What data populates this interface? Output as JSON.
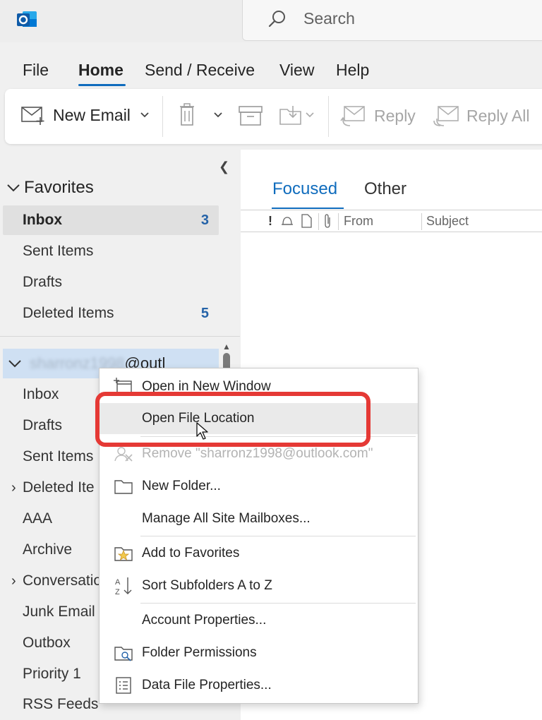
{
  "titlebar": {
    "app_icon": "outlook-logo-icon",
    "search_placeholder": "Search"
  },
  "menu_tabs": [
    {
      "label": "File",
      "active": false
    },
    {
      "label": "Home",
      "active": true
    },
    {
      "label": "Send / Receive",
      "active": false
    },
    {
      "label": "View",
      "active": false
    },
    {
      "label": "Help",
      "active": false
    }
  ],
  "ribbon": {
    "new_email": "New Email",
    "reply": "Reply",
    "reply_all": "Reply All"
  },
  "favorites": {
    "header": "Favorites",
    "items": [
      {
        "label": "Inbox",
        "count": "3",
        "selected": true
      },
      {
        "label": "Sent Items",
        "count": ""
      },
      {
        "label": "Drafts",
        "count": ""
      },
      {
        "label": "Deleted Items",
        "count": "5"
      }
    ]
  },
  "account": {
    "name_visible": "@outl",
    "name_blurred": "sharronz1998",
    "folders": [
      {
        "label": "Inbox",
        "expandable": false
      },
      {
        "label": "Drafts",
        "expandable": false
      },
      {
        "label": "Sent Items",
        "expandable": false
      },
      {
        "label": "Deleted Ite",
        "expandable": true
      },
      {
        "label": "AAA",
        "expandable": false
      },
      {
        "label": "Archive",
        "expandable": false
      },
      {
        "label": "Conversatio",
        "expandable": true
      },
      {
        "label": "Junk Email",
        "expandable": false
      },
      {
        "label": "Outbox",
        "expandable": false
      },
      {
        "label": "Priority 1",
        "expandable": false
      },
      {
        "label": "RSS Feeds",
        "expandable": false
      }
    ]
  },
  "mail_list": {
    "tabs": [
      {
        "label": "Focused",
        "active": true
      },
      {
        "label": "Other",
        "active": false
      }
    ],
    "columns": {
      "from": "From",
      "subject": "Subject"
    }
  },
  "context_menu": {
    "items": [
      {
        "label": "Open in New Window",
        "icon": "new-window-icon",
        "disabled": false
      },
      {
        "label": "Open File Location",
        "icon": "",
        "disabled": false,
        "hover": true
      },
      {
        "label": "Remove \"sharronz1998@outlook.com\"",
        "icon": "remove-icon",
        "disabled": true
      },
      {
        "label": "New Folder...",
        "icon": "folder-icon",
        "disabled": false
      },
      {
        "label": "Manage All Site Mailboxes...",
        "icon": "",
        "disabled": false
      },
      {
        "label": "Add to Favorites",
        "icon": "star-folder-icon",
        "disabled": false
      },
      {
        "label": "Sort Subfolders A to Z",
        "icon": "sort-az-icon",
        "disabled": false
      },
      {
        "label": "Account Properties...",
        "icon": "",
        "disabled": false
      },
      {
        "label": "Folder Permissions",
        "icon": "folder-permissions-icon",
        "disabled": false
      },
      {
        "label": "Data File Properties...",
        "icon": "properties-icon",
        "disabled": false
      }
    ]
  },
  "colors": {
    "accent": "#0f6cbd",
    "highlight_border": "#e53935",
    "selected_bg": "#e0e0e0",
    "account_bg": "#cfe0f3"
  }
}
